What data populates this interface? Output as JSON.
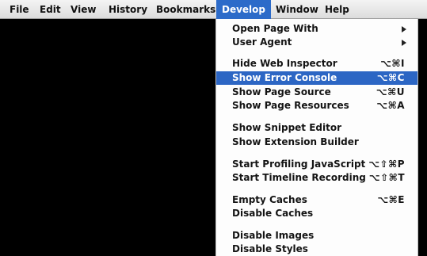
{
  "menubar": {
    "items": [
      {
        "label": "File"
      },
      {
        "label": "Edit"
      },
      {
        "label": "View"
      },
      {
        "label": "History"
      },
      {
        "label": "Bookmarks"
      },
      {
        "label": "Develop"
      },
      {
        "label": "Window"
      },
      {
        "label": "Help"
      }
    ],
    "active": "Develop"
  },
  "develop_menu": {
    "items": [
      {
        "label": "Open Page With",
        "submenu": true
      },
      {
        "label": "User Agent",
        "submenu": true
      },
      {
        "label": "Hide Web Inspector",
        "shortcut": "⌥⌘I"
      },
      {
        "label": "Show Error Console",
        "shortcut": "⌥⌘C",
        "highlighted": true
      },
      {
        "label": "Show Page Source",
        "shortcut": "⌥⌘U"
      },
      {
        "label": "Show Page Resources",
        "shortcut": "⌥⌘A"
      },
      {
        "label": "Show Snippet Editor"
      },
      {
        "label": "Show Extension Builder"
      },
      {
        "label": "Start Profiling JavaScript",
        "shortcut": "⌥⇧⌘P"
      },
      {
        "label": "Start Timeline Recording",
        "shortcut": "⌥⇧⌘T"
      },
      {
        "label": "Empty Caches",
        "shortcut": "⌥⌘E"
      },
      {
        "label": "Disable Caches"
      },
      {
        "label": "Disable Images"
      },
      {
        "label": "Disable Styles"
      }
    ]
  },
  "colors": {
    "highlight": "#2c66c4",
    "menubar": "#e8e8e8",
    "background": "#000000"
  },
  "icons": {
    "submenu": "triangle-right-icon"
  }
}
